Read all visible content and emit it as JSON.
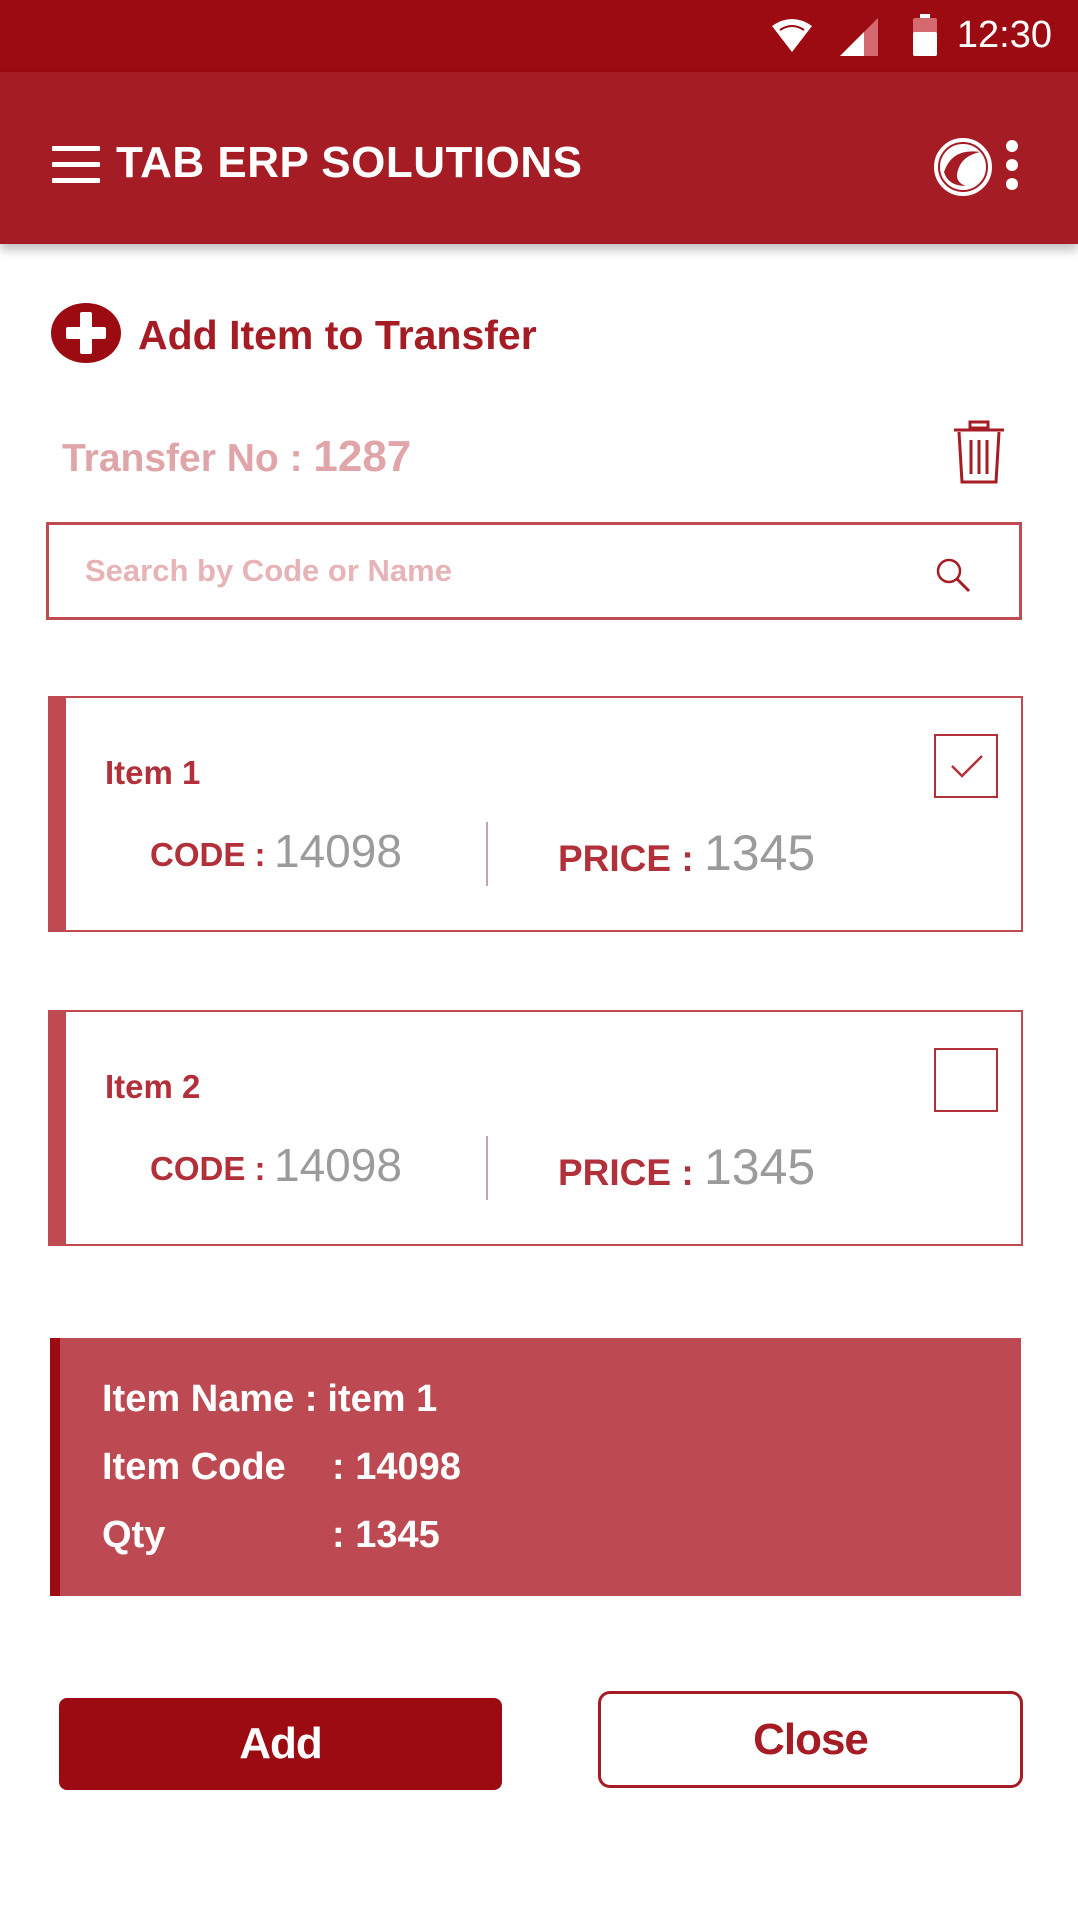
{
  "status_bar": {
    "time": "12:30"
  },
  "app_bar": {
    "title": "TAB ERP SOLUTIONS"
  },
  "section": {
    "title": "Add Item to Transfer"
  },
  "transfer": {
    "label": "Transfer No : ",
    "number": "1287"
  },
  "search": {
    "placeholder": "Search by Code or Name",
    "value": ""
  },
  "items": [
    {
      "name": "Item 1",
      "code_label": "CODE",
      "sep": ":",
      "code": "14098",
      "price_label": "PRICE",
      "price": "1345",
      "checked": true
    },
    {
      "name": "Item 2",
      "code_label": "CODE",
      "sep": ":",
      "code": "14098",
      "price_label": "PRICE",
      "price": "1345",
      "checked": false
    }
  ],
  "details": {
    "name_label": "Item Name :",
    "name_value": "item 1",
    "code_label": "Item Code",
    "code_value": ": 14098",
    "qty_label": "Qty",
    "qty_value": ": 1345"
  },
  "buttons": {
    "add": "Add",
    "close": "Close"
  },
  "colors": {
    "primary": "#9c0a12",
    "app_bar": "#a51c24",
    "accent": "#c04a52",
    "muted": "#9b9b9b"
  },
  "icons": [
    "wifi-icon",
    "signal-icon",
    "battery-icon",
    "menu-icon",
    "logo-icon",
    "more-vert-icon",
    "add-circle-icon",
    "trash-icon",
    "search-icon",
    "check-icon"
  ]
}
